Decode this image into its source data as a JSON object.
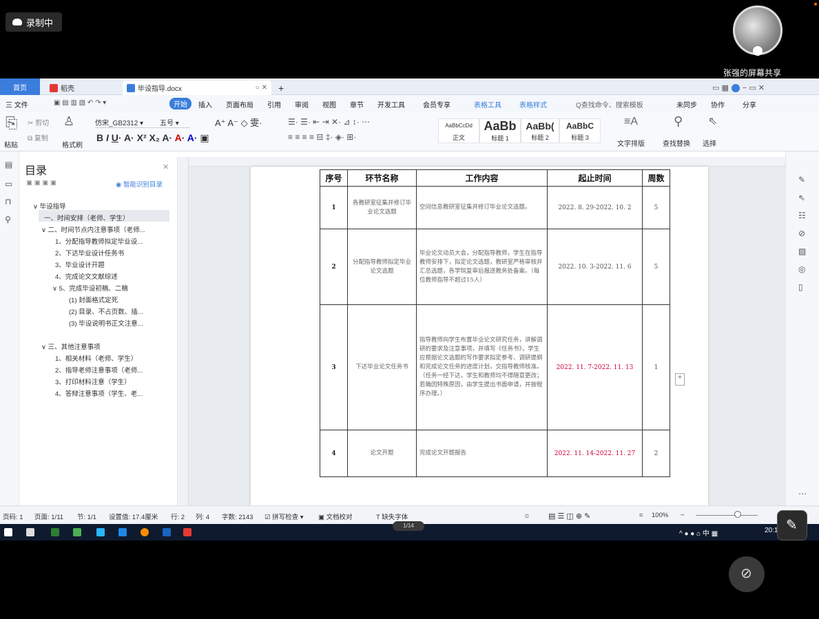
{
  "recording": {
    "label": "录制中"
  },
  "presenter": {
    "label": "张强的屏幕共享"
  },
  "tabs": {
    "home": "首页",
    "docer": "稻壳",
    "doc": "毕设指导.docx"
  },
  "menu": [
    "三 文件",
    "开始",
    "插入",
    "页面布局",
    "引用",
    "审阅",
    "视图",
    "章节",
    "开发工具",
    "会员专享",
    "表格工具",
    "表格样式",
    "Q查找命令、搜索模板",
    "未同步",
    "协作",
    "分享"
  ],
  "ribbon": {
    "paste": "粘贴",
    "cut": "剪切",
    "copy": "复制",
    "format_painter": "格式刷",
    "font": "仿宋_GB2312",
    "size": "五号",
    "styles": [
      {
        "preview": "AaBbCcDd",
        "name": "正文"
      },
      {
        "preview": "AaBb",
        "name": "标题 1"
      },
      {
        "preview": "AaBb(",
        "name": "标题 2"
      },
      {
        "preview": "AaBbC",
        "name": "标题 3"
      }
    ],
    "text_layout": "文字排版",
    "find_replace": "查找替换",
    "select": "选择"
  },
  "nav": {
    "title": "目录",
    "smart": "智能识别目录",
    "items": [
      "∨ 毕设指导",
      "一、时间安排（老师、学生）",
      "∨ 二、时间节点内注意事项（老师...",
      "1、分配指导教师拟定毕业设...",
      "2、下达毕业设计任务书",
      "3、毕业设计开题",
      "4、完成论文文献综述",
      "∨ 5、完成毕设初稿、二稿",
      "(1) 封面格式定死",
      "(2) 目录、不占页数、插...",
      "(3) 毕设说明书正文注意...",
      "∨ 三、其他注意事项",
      "1、相关材料（老师、学生）",
      "2、指导老师注意事项（老师...",
      "3、打印材料注意（学生）",
      "4、答辩注意事项（学生、老..."
    ]
  },
  "table": {
    "headers": [
      "序号",
      "环节名称",
      "工作内容",
      "起止时间",
      "周数"
    ],
    "rows": [
      {
        "no": "1",
        "name": "各教研室征集并修订毕业论文选题",
        "content": "空间信息教研室征集并修订毕业论文选题。",
        "period": "2022. 8. 29-2022. 10. 2",
        "weeks": "5"
      },
      {
        "no": "2",
        "name": "分配指导教师拟定毕业论文选题",
        "content": "毕业论文动员大会，分配指导教师，学生在指导教师安排下，拟定论文选题，教研室严格审核并汇总选题，各学院复审后报送教务处备案。（每位教师指导不超过15人）",
        "period": "2022. 10. 3-2022. 11. 6",
        "weeks": "5"
      },
      {
        "no": "3",
        "name": "下达毕业论文任务书",
        "content": "指导教师向学生布置毕业论文研究任务，讲解调研的要求及注意事项，并填写《任务书》，学生应根据论文选题的写作要求拟定参考、调研提纲和完成论文任务的进度计划，交指导教师核准。（任务一经下达，学生和教师均不得随意更改；若确因特殊原因，由学生提出书面申请，并按程序办理。）",
        "period": "2022. 11. 7-2022. 11. 13",
        "weeks": "1"
      },
      {
        "no": "4",
        "name": "论文开题",
        "content": "完成论文开题报告",
        "period": "2022. 11. 14-2022. 11. 27",
        "weeks": "2"
      }
    ]
  },
  "status": {
    "page_no": "页码: 1",
    "pages": "页面: 1/11",
    "section": "节: 1/1",
    "setting": "设置值: 17.4厘米",
    "row": "行: 2",
    "col": "列: 4",
    "words": "字数: 2143",
    "spell": "拼写检查",
    "proof": "文档校对",
    "missing_font": "缺失字体",
    "zoom": "100%"
  },
  "page_indicator": "1/14",
  "clock": "20:1"
}
